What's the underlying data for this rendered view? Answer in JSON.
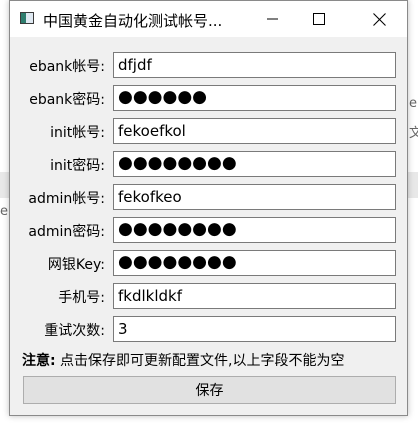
{
  "background": {
    "fragments": [
      "e",
      "文",
      "e"
    ]
  },
  "window": {
    "title": "中国黄金自动化测试帐号...",
    "buttons": {
      "minimize_icon": "minimize-icon",
      "maximize_icon": "maximize-icon",
      "close_icon": "close-icon"
    }
  },
  "form": {
    "fields": [
      {
        "label": "ebank帐号:",
        "value": "dfjdf"
      },
      {
        "label": "ebank密码:",
        "value": "●●●●●●"
      },
      {
        "label": "init帐号:",
        "value": "fekoefkol"
      },
      {
        "label": "init密码:",
        "value": "●●●●●●●●"
      },
      {
        "label": "admin帐号:",
        "value": "fekofkeo"
      },
      {
        "label": "admin密码:",
        "value": "●●●●●●●●"
      },
      {
        "label": "网银Key:",
        "value": "●●●●●●●●"
      },
      {
        "label": "手机号:",
        "value": "fkdlkldkf"
      },
      {
        "label": "重试次数:",
        "value": "3"
      }
    ]
  },
  "note": {
    "prefix": "注意:",
    "text": " 点击保存即可更新配置文件,以上字段不能为空"
  },
  "save_button": {
    "label": "保存"
  }
}
